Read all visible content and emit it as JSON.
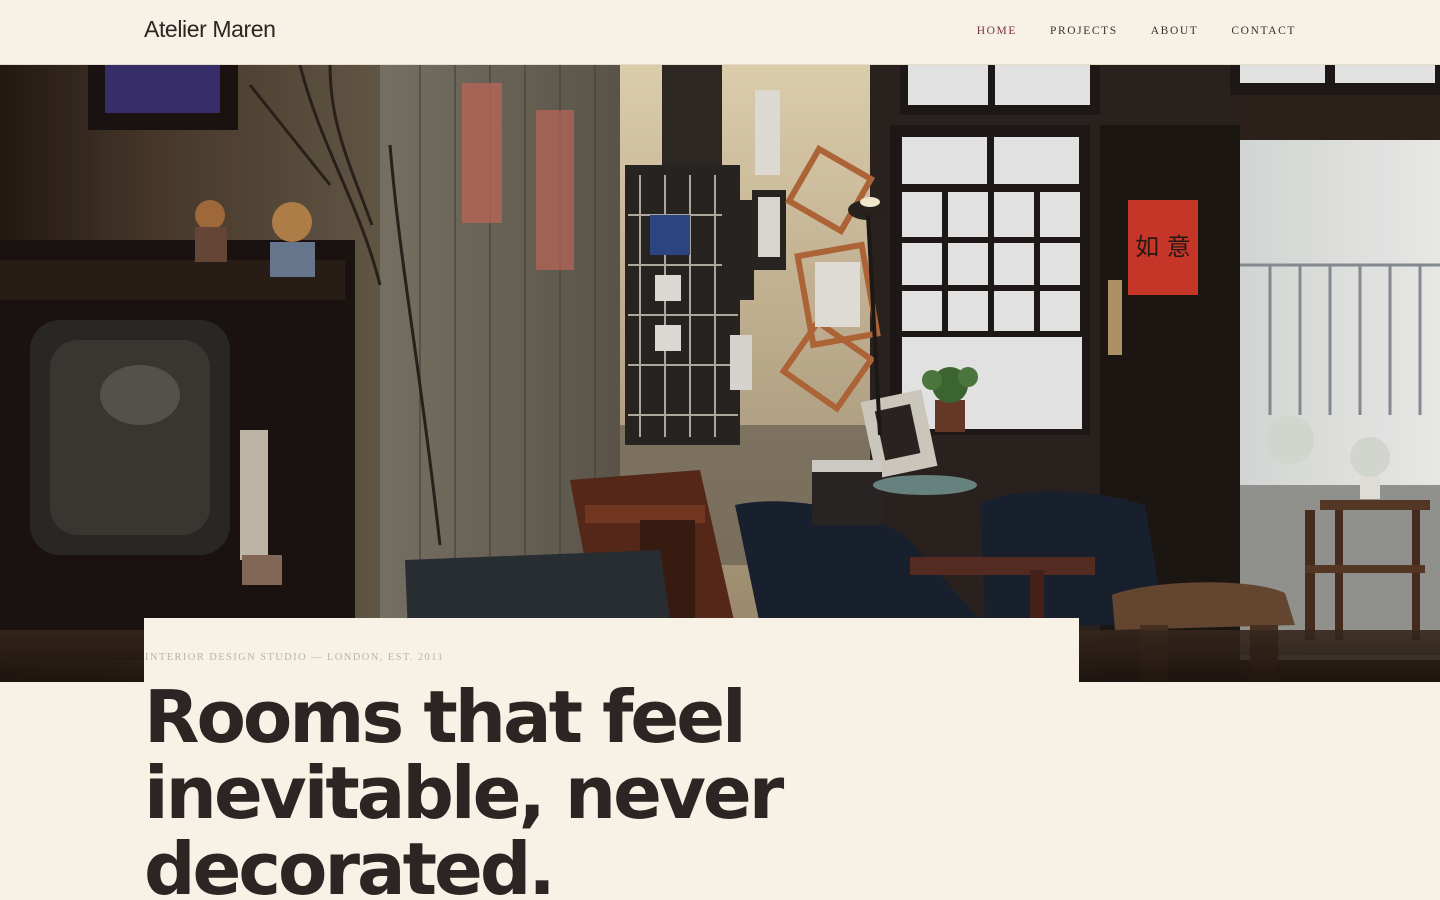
{
  "brand": {
    "name": "Atelier Maren"
  },
  "nav": {
    "items": [
      {
        "label": "HOME",
        "active": true
      },
      {
        "label": "PROJECTS",
        "active": false
      },
      {
        "label": "ABOUT",
        "active": false
      },
      {
        "label": "CONTACT",
        "active": false
      }
    ]
  },
  "hero": {
    "image_alt": "Vintage cafe interior with wooden chairs, framed photos and a window",
    "sign_text": "如 意",
    "eyebrow": "INTERIOR DESIGN STUDIO — LONDON, EST. 2011",
    "headline_lines": [
      "Rooms that feel",
      "inevitable, never",
      "decorated."
    ]
  },
  "colors": {
    "background": "#f7f1e6",
    "text": "#2b2523",
    "accent": "#7a2e4a",
    "muted": "#bdb3a8"
  }
}
